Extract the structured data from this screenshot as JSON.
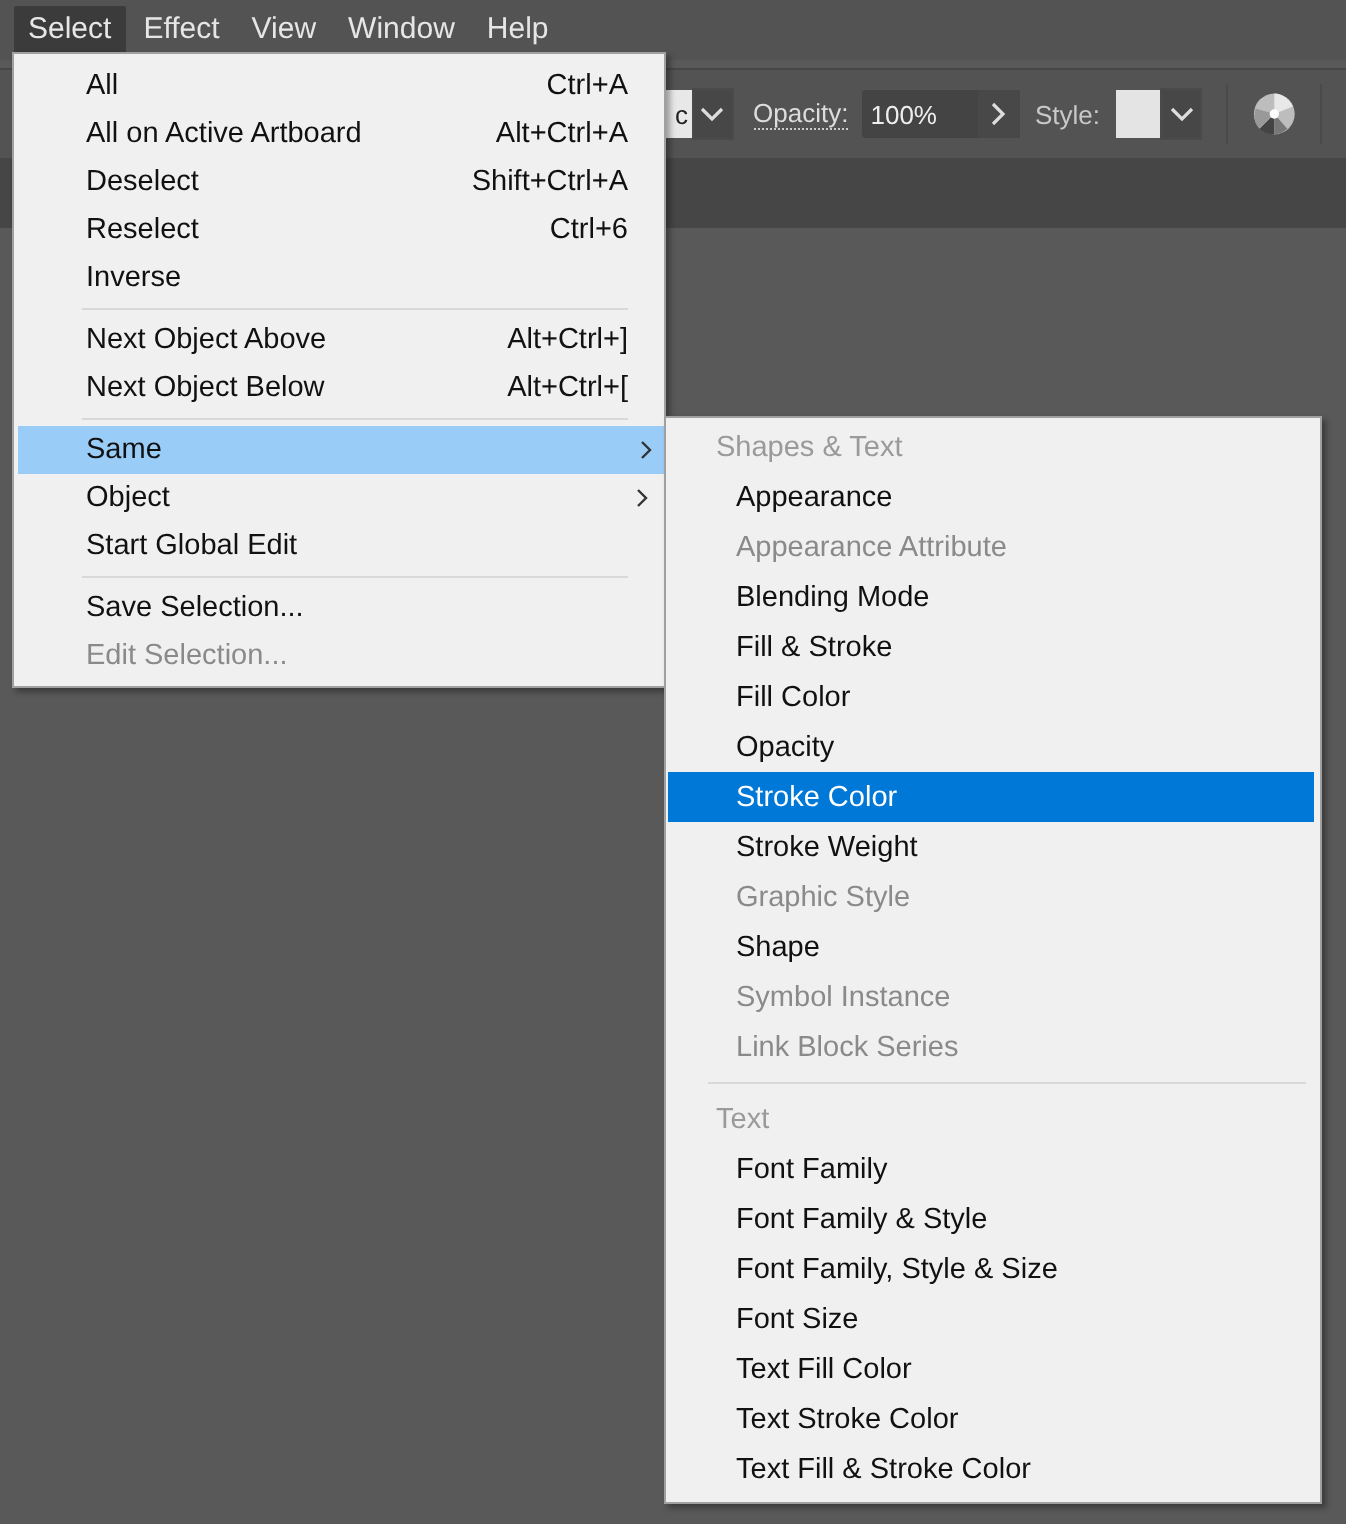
{
  "menubar": [
    {
      "label": "Select",
      "selected": true
    },
    {
      "label": "Effect",
      "selected": false
    },
    {
      "label": "View",
      "selected": false
    },
    {
      "label": "Window",
      "selected": false
    },
    {
      "label": "Help",
      "selected": false
    }
  ],
  "toolbar": {
    "partial_field_value": "c",
    "opacity_label": "Opacity:",
    "opacity_value": "100%",
    "style_label": "Style:"
  },
  "select_menu": {
    "groups": [
      [
        {
          "label": "All",
          "shortcut": "Ctrl+A",
          "submenu": false,
          "selected": false,
          "disabled": false
        },
        {
          "label": "All on Active Artboard",
          "shortcut": "Alt+Ctrl+A",
          "submenu": false,
          "selected": false,
          "disabled": false
        },
        {
          "label": "Deselect",
          "shortcut": "Shift+Ctrl+A",
          "submenu": false,
          "selected": false,
          "disabled": false
        },
        {
          "label": "Reselect",
          "shortcut": "Ctrl+6",
          "submenu": false,
          "selected": false,
          "disabled": false
        },
        {
          "label": "Inverse",
          "submenu": false,
          "selected": false,
          "disabled": false
        }
      ],
      [
        {
          "label": "Next Object Above",
          "shortcut": "Alt+Ctrl+]",
          "submenu": false,
          "selected": false,
          "disabled": false
        },
        {
          "label": "Next Object Below",
          "shortcut": "Alt+Ctrl+[",
          "submenu": false,
          "selected": false,
          "disabled": false
        }
      ],
      [
        {
          "label": "Same",
          "submenu": true,
          "selected": true,
          "disabled": false
        },
        {
          "label": "Object",
          "submenu": true,
          "selected": false,
          "disabled": false
        },
        {
          "label": "Start Global Edit",
          "submenu": false,
          "selected": false,
          "disabled": false
        }
      ],
      [
        {
          "label": "Save Selection...",
          "submenu": false,
          "selected": false,
          "disabled": false
        },
        {
          "label": "Edit Selection...",
          "submenu": false,
          "selected": false,
          "disabled": true
        }
      ]
    ]
  },
  "same_submenu": {
    "sections": [
      {
        "header": "Shapes & Text",
        "items": [
          {
            "label": "Appearance",
            "disabled": false,
            "selected": false
          },
          {
            "label": "Appearance Attribute",
            "disabled": true,
            "selected": false
          },
          {
            "label": "Blending Mode",
            "disabled": false,
            "selected": false
          },
          {
            "label": "Fill & Stroke",
            "disabled": false,
            "selected": false
          },
          {
            "label": "Fill Color",
            "disabled": false,
            "selected": false
          },
          {
            "label": "Opacity",
            "disabled": false,
            "selected": false
          },
          {
            "label": "Stroke Color",
            "disabled": false,
            "selected": true
          },
          {
            "label": "Stroke Weight",
            "disabled": false,
            "selected": false
          },
          {
            "label": "Graphic Style",
            "disabled": true,
            "selected": false
          },
          {
            "label": "Shape",
            "disabled": false,
            "selected": false
          },
          {
            "label": "Symbol Instance",
            "disabled": true,
            "selected": false
          },
          {
            "label": "Link Block Series",
            "disabled": true,
            "selected": false
          }
        ]
      },
      {
        "header": "Text",
        "items": [
          {
            "label": "Font Family",
            "disabled": false,
            "selected": false
          },
          {
            "label": "Font Family & Style",
            "disabled": false,
            "selected": false
          },
          {
            "label": "Font Family, Style & Size",
            "disabled": false,
            "selected": false
          },
          {
            "label": "Font Size",
            "disabled": false,
            "selected": false
          },
          {
            "label": "Text Fill Color",
            "disabled": false,
            "selected": false
          },
          {
            "label": "Text Stroke Color",
            "disabled": false,
            "selected": false
          },
          {
            "label": "Text Fill & Stroke Color",
            "disabled": false,
            "selected": false
          }
        ]
      }
    ]
  }
}
